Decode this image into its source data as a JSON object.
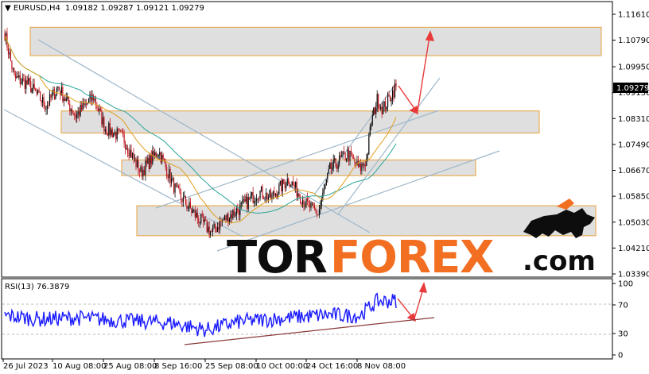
{
  "header": {
    "symbol": "EURUSD,H4",
    "ohlc": "1.09182 1.09287 1.09121 1.09279"
  },
  "rsi_header": "RSI(13) 76.3879",
  "watermark": {
    "part1": "TOR",
    "part2": "FOREX",
    "part3": ".com"
  },
  "colors": {
    "bull": "#0a0a0a",
    "bear": "#c0141c",
    "ma_fast": "#e0a020",
    "ma_slow": "#2aa59a",
    "zone_fill": "#d9d9d9",
    "zone_border": "#e8a23a",
    "channel": "#9fb7c9",
    "arrow": "#e83a3a",
    "rsi_line": "#1a1aff",
    "rsi_trend": "#8b3a3a"
  },
  "chart_data": {
    "type": "candlestick",
    "timeframe": "H4",
    "ylim": [
      1.0339,
      1.1161
    ],
    "y_ticks": [
      "1.11610",
      "1.10790",
      "1.09950",
      "1.09130",
      "1.08310",
      "1.07490",
      "1.06670",
      "1.05850",
      "1.05030",
      "1.04210",
      "1.03390"
    ],
    "x_ticks": [
      "26 Jul 2023",
      "10 Aug 08:00",
      "25 Aug 08:00",
      "8 Sep 16:00",
      "25 Sep 08:00",
      "10 Oct 00:00",
      "24 Oct 16:00",
      "8 Nov 08:00"
    ],
    "current_price": "1.09279",
    "anchors": [
      [
        0,
        1.11
      ],
      [
        8,
        1.096
      ],
      [
        20,
        1.094
      ],
      [
        35,
        1.087
      ],
      [
        45,
        1.093
      ],
      [
        60,
        1.084
      ],
      [
        75,
        1.09
      ],
      [
        85,
        1.08
      ],
      [
        100,
        1.077
      ],
      [
        115,
        1.066
      ],
      [
        130,
        1.073
      ],
      [
        145,
        1.06
      ],
      [
        160,
        1.053
      ],
      [
        175,
        1.047
      ],
      [
        185,
        1.051
      ],
      [
        200,
        1.055
      ],
      [
        215,
        1.06
      ],
      [
        225,
        1.058
      ],
      [
        240,
        1.064
      ],
      [
        255,
        1.056
      ],
      [
        265,
        1.053
      ],
      [
        275,
        1.067
      ],
      [
        290,
        1.072
      ],
      [
        300,
        1.067
      ],
      [
        306,
        1.07
      ],
      [
        310,
        1.082
      ],
      [
        315,
        1.089
      ],
      [
        320,
        1.086
      ],
      [
        330,
        1.0928
      ]
    ],
    "zones": [
      {
        "top": 1.112,
        "bottom": 1.103
      },
      {
        "top": 1.0855,
        "bottom": 1.0785
      },
      {
        "top": 1.07,
        "bottom": 1.065
      },
      {
        "top": 1.0555,
        "bottom": 1.046
      }
    ],
    "rsi": {
      "period": 13,
      "value": 76.3879,
      "levels": [
        70,
        30
      ],
      "y_ticks": [
        "100",
        "70",
        "30",
        "0"
      ],
      "anchors": [
        [
          0,
          55
        ],
        [
          30,
          50
        ],
        [
          60,
          52
        ],
        [
          100,
          48
        ],
        [
          140,
          45
        ],
        [
          170,
          35
        ],
        [
          200,
          47
        ],
        [
          240,
          52
        ],
        [
          270,
          56
        ],
        [
          300,
          55
        ],
        [
          315,
          75
        ],
        [
          330,
          76
        ]
      ]
    }
  }
}
